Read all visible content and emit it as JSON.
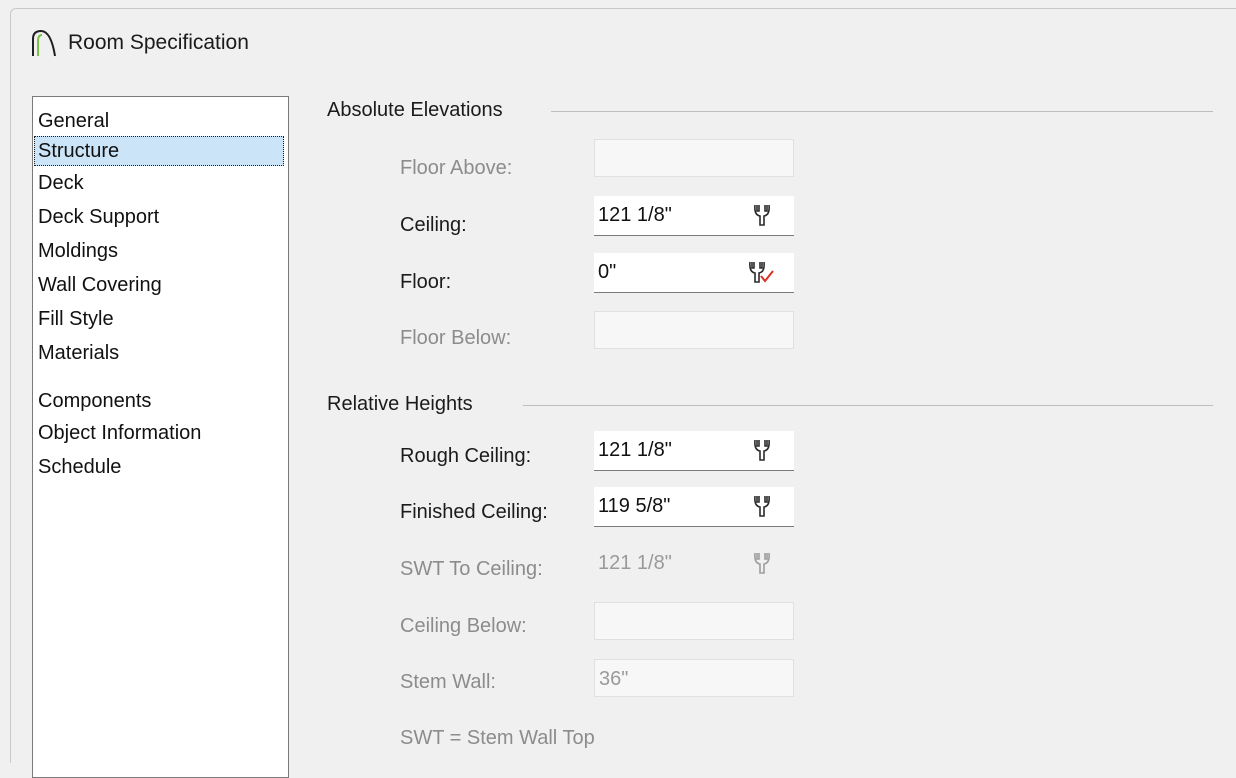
{
  "window": {
    "title": "Room Specification",
    "icon": "arch-icon"
  },
  "nav": {
    "selected": "Structure",
    "items": [
      {
        "label": "General"
      },
      {
        "label": "Structure"
      },
      {
        "label": "Deck"
      },
      {
        "label": "Deck Support"
      },
      {
        "label": "Moldings"
      },
      {
        "label": "Wall Covering"
      },
      {
        "label": "Fill Style"
      },
      {
        "label": "Materials"
      },
      {
        "label": "Components"
      },
      {
        "label": "Object Information"
      },
      {
        "label": "Schedule"
      }
    ]
  },
  "absolute": {
    "title": "Absolute Elevations",
    "floor_above": {
      "label": "Floor Above:",
      "value": "",
      "enabled": false
    },
    "ceiling": {
      "label": "Ceiling:",
      "value": "121 1/8\"",
      "enabled": true,
      "icon": "wrench-icon"
    },
    "floor": {
      "label": "Floor:",
      "value": "0\"",
      "enabled": true,
      "icon": "wrench-check-icon"
    },
    "floor_below": {
      "label": "Floor Below:",
      "value": "",
      "enabled": false
    }
  },
  "relative": {
    "title": "Relative Heights",
    "rough_ceiling": {
      "label": "Rough Ceiling:",
      "value": "121 1/8\"",
      "enabled": true,
      "icon": "wrench-icon"
    },
    "finished_ceiling": {
      "label": "Finished Ceiling:",
      "value": "119 5/8\"",
      "enabled": true,
      "icon": "wrench-icon"
    },
    "swt_to_ceiling": {
      "label": "SWT To Ceiling:",
      "value": "121 1/8\"",
      "enabled": false,
      "icon": "wrench-icon"
    },
    "ceiling_below": {
      "label": "Ceiling Below:",
      "value": "",
      "enabled": false
    },
    "stem_wall": {
      "label": "Stem Wall:",
      "value": "36\"",
      "enabled": false
    }
  },
  "note": "SWT = Stem Wall Top",
  "colors": {
    "selection": "#cce4f7",
    "check": "#d93025",
    "disabled_text": "#8c8c8c"
  }
}
